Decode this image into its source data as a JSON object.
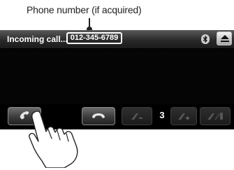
{
  "annotation": {
    "label": "Phone number (if acquired)"
  },
  "call_screen": {
    "title": "Incoming call...",
    "phone_number": "012-345-6789"
  },
  "volume": {
    "value": "3"
  },
  "icons": {
    "bluetooth": "bluetooth-icon",
    "eject": "eject-icon",
    "answer": "phone-answer-icon",
    "hangup": "phone-hangup-icon",
    "vol_down": "volume-down-icon",
    "vol_up": "volume-up-icon",
    "handset": "handset-switch-icon",
    "hand": "pointing-hand-icon"
  },
  "colors": {
    "screen_bg": "#050505",
    "topbar": "#2a2a2a",
    "text": "#ffffff"
  }
}
